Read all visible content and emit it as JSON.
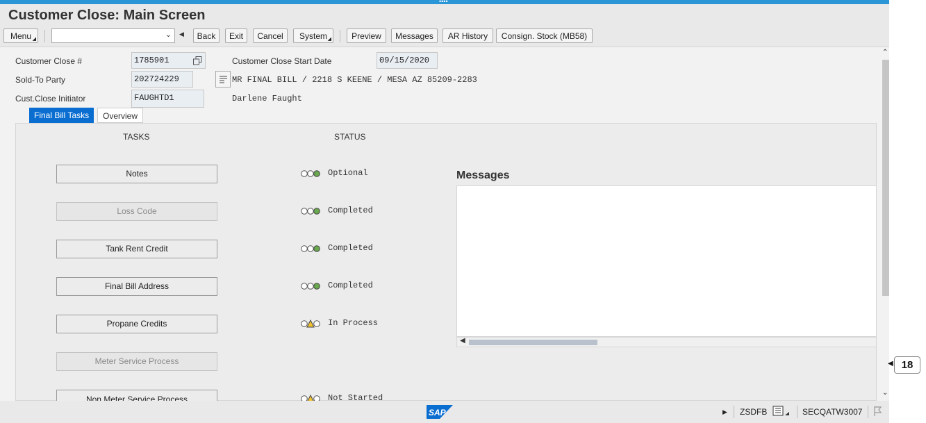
{
  "window": {
    "title": "Customer Close: Main Screen",
    "drag_handle": "••••"
  },
  "toolbar": {
    "menu": "Menu",
    "back": "Back",
    "exit": "Exit",
    "cancel": "Cancel",
    "system": "System",
    "preview": "Preview",
    "messages": "Messages",
    "ar_history": "AR History",
    "consign_stock": "Consign. Stock (MB58)"
  },
  "header": {
    "close_no_label": "Customer Close #",
    "close_no_value": "1785901",
    "start_date_label": "Customer Close Start Date",
    "start_date_value": "09/15/2020",
    "sold_to_label": "Sold-To Party",
    "sold_to_value": "202724229",
    "sold_to_address": "MR FINAL BILL / 2218 S KEENE / MESA AZ 85209-2283",
    "initiator_label": "Cust.Close Initiator",
    "initiator_value": "FAUGHTD1",
    "initiator_name": "Darlene Faught"
  },
  "tabs": [
    {
      "label": "Final Bill Tasks",
      "active": true
    },
    {
      "label": "Overview",
      "active": false
    }
  ],
  "columns": {
    "tasks": "TASKS",
    "status": "STATUS"
  },
  "tasks": [
    {
      "label": "Notes",
      "enabled": true,
      "status": "Optional",
      "light": "green"
    },
    {
      "label": "Loss Code",
      "enabled": false,
      "status": "Completed",
      "light": "green"
    },
    {
      "label": "Tank Rent Credit",
      "enabled": true,
      "status": "Completed",
      "light": "green"
    },
    {
      "label": "Final Bill Address",
      "enabled": true,
      "status": "Completed",
      "light": "green"
    },
    {
      "label": "Propane Credits",
      "enabled": true,
      "status": "In Process",
      "light": "yellow"
    },
    {
      "label": "Meter Service Process",
      "enabled": false,
      "status": "",
      "light": "none"
    },
    {
      "label": "Non Meter Service Process",
      "enabled": true,
      "status": "Not Started",
      "light": "yellow"
    }
  ],
  "messages": {
    "title": "Messages"
  },
  "statusbar": {
    "logo": "SAP",
    "transaction": "ZSDFB",
    "system": "SECQATW3007"
  },
  "badge": {
    "count": "18"
  },
  "colors": {
    "accent": "#0a6ed1",
    "topbar": "#2a96d8",
    "green_light": "#6aa84f",
    "yellow_light": "#f1c232"
  }
}
